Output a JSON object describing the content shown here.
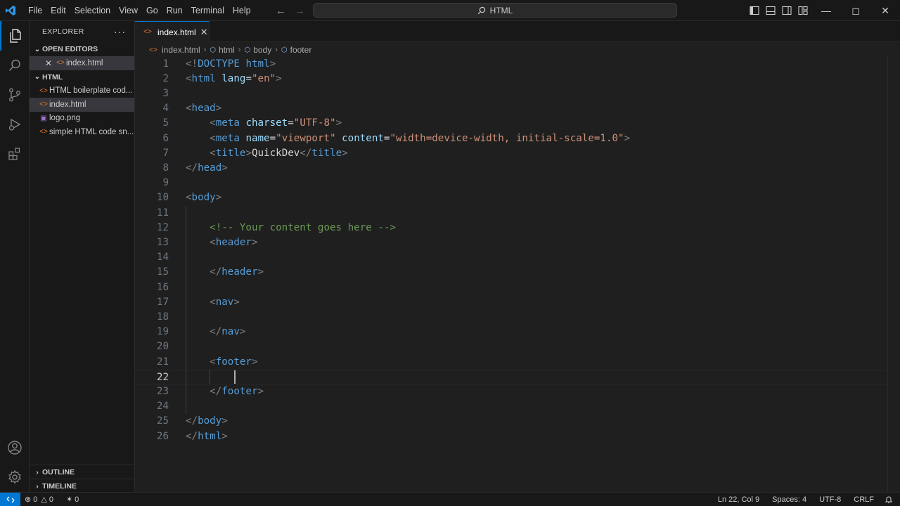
{
  "menu": [
    "File",
    "Edit",
    "Selection",
    "View",
    "Go",
    "Run",
    "Terminal",
    "Help"
  ],
  "command_center": "HTML",
  "sidebar": {
    "title": "EXPLORER",
    "open_editors_label": "OPEN EDITORS",
    "open_editors": [
      {
        "name": "index.html"
      }
    ],
    "folder_label": "HTML",
    "files": [
      {
        "name": "HTML boilerplate cod...",
        "type": "html"
      },
      {
        "name": "index.html",
        "type": "html",
        "selected": true
      },
      {
        "name": "logo.png",
        "type": "image"
      },
      {
        "name": "simple HTML code sn...",
        "type": "html"
      }
    ],
    "outline_label": "OUTLINE",
    "timeline_label": "TIMELINE"
  },
  "tab": {
    "label": "index.html"
  },
  "breadcrumb": [
    "index.html",
    "html",
    "body",
    "footer"
  ],
  "editor": {
    "lines": [
      "<!DOCTYPE html>",
      "<html lang=\"en\">",
      "",
      "<head>",
      "    <meta charset=\"UTF-8\">",
      "    <meta name=\"viewport\" content=\"width=device-width, initial-scale=1.0\">",
      "    <title>QuickDev</title>",
      "</head>",
      "",
      "<body>",
      "",
      "    <!-- Your content goes here -->",
      "    <header>",
      "",
      "    </header>",
      "",
      "    <nav>",
      "",
      "    </nav>",
      "",
      "    <footer>",
      "        ",
      "    </footer>",
      "",
      "</body>",
      "</html>"
    ],
    "current_line": 22
  },
  "status": {
    "errors": "0",
    "warnings": "0",
    "ports": "0",
    "position": "Ln 22, Col 9",
    "spaces": "Spaces: 4",
    "encoding": "UTF-8",
    "eol": "CRLF"
  },
  "colors": {
    "accent": "#0078d4",
    "tag": "#569cd6",
    "attr": "#9cdcfe",
    "string": "#ce9178",
    "comment": "#6a9955"
  }
}
